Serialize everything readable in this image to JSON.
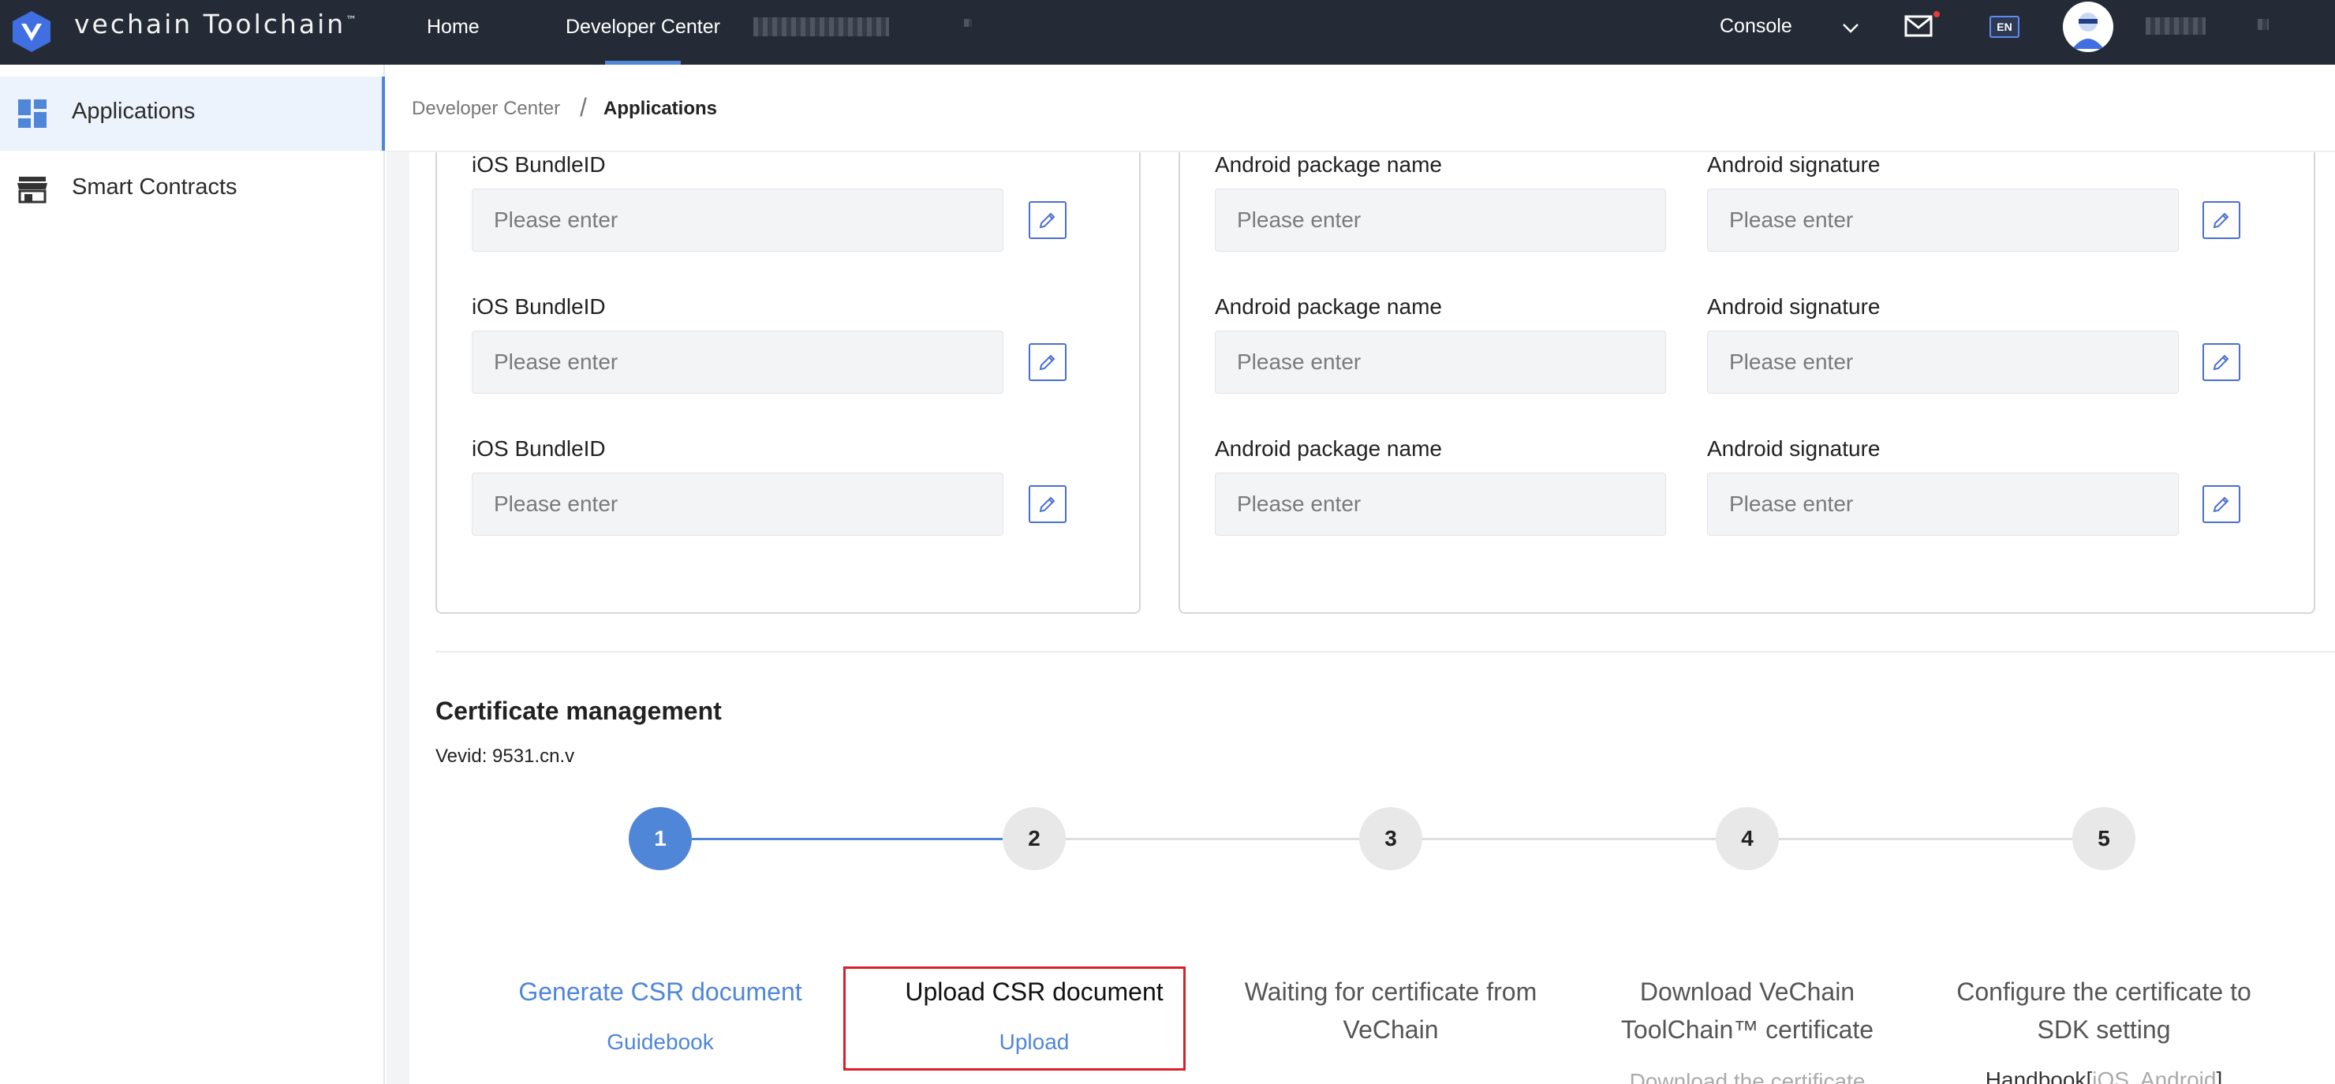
{
  "topbar": {
    "brand": "vechain Toolchain",
    "brand_tm": "™",
    "nav": {
      "home": "Home",
      "developer_center": "Developer Center"
    },
    "console": "Console",
    "lang": "EN",
    "accent": "#4f86d8"
  },
  "sidebar": {
    "items": [
      {
        "label": "Applications",
        "icon": "dashboard-icon",
        "active": true
      },
      {
        "label": "Smart Contracts",
        "icon": "store-icon",
        "active": false
      }
    ]
  },
  "breadcrumb": {
    "root": "Developer Center",
    "separator": "/",
    "current": "Applications"
  },
  "ios_fields": [
    {
      "label": "iOS BundleID",
      "placeholder": "Please enter"
    },
    {
      "label": "iOS BundleID",
      "placeholder": "Please enter"
    },
    {
      "label": "iOS BundleID",
      "placeholder": "Please enter"
    }
  ],
  "android_fields": [
    {
      "package_label": "Android package name",
      "package_placeholder": "Please enter",
      "signature_label": "Android signature",
      "signature_placeholder": "Please enter"
    },
    {
      "package_label": "Android package name",
      "package_placeholder": "Please enter",
      "signature_label": "Android signature",
      "signature_placeholder": "Please enter"
    },
    {
      "package_label": "Android package name",
      "package_placeholder": "Please enter",
      "signature_label": "Android signature",
      "signature_placeholder": "Please enter"
    }
  ],
  "certificate": {
    "title": "Certificate management",
    "vevid": "Vevid: 9531.cn.v",
    "steps": [
      {
        "number": "1",
        "title_line1": "Generate CSR document",
        "title_line2": "",
        "link": "Guidebook",
        "state": "active"
      },
      {
        "number": "2",
        "title_line1": "Upload CSR document",
        "title_line2": "",
        "link": "Upload",
        "state": "current"
      },
      {
        "number": "3",
        "title_line1": "Waiting for certificate from",
        "title_line2": "VeChain",
        "link": "",
        "state": "pending"
      },
      {
        "number": "4",
        "title_line1": "Download VeChain",
        "title_line2": "ToolChain™ certificate",
        "link": "Download the certificate",
        "state": "pending"
      },
      {
        "number": "5",
        "title_line1": "Configure the certificate to",
        "title_line2": "SDK setting",
        "handbook": "Handbook",
        "bracket_open": "[",
        "ios": "iOS",
        "comma": ", ",
        "android": "Android",
        "bracket_close": "]",
        "state": "pending"
      }
    ]
  }
}
